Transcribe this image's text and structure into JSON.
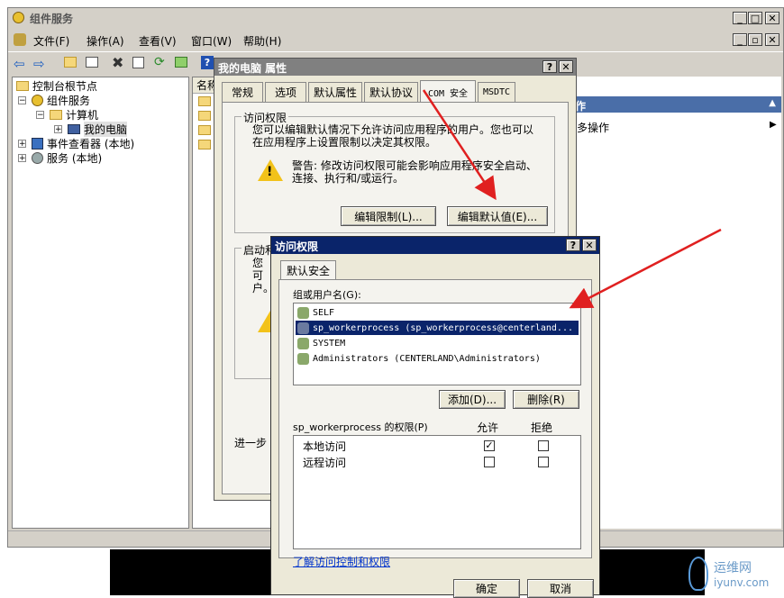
{
  "app": {
    "title": "组件服务",
    "menu": [
      "文件(F)",
      "操作(A)",
      "查看(V)",
      "窗口(W)",
      "帮助(H)"
    ]
  },
  "tree": {
    "root": "控制台根节点",
    "component_services": "组件服务",
    "computers": "计算机",
    "my_computer": "我的电脑",
    "event_viewer": "事件查看器 (本地)",
    "services": "服务 (本地)"
  },
  "list": {
    "column_header": "名称"
  },
  "actions": {
    "header": "作",
    "more": "多操作"
  },
  "props": {
    "title": "我的电脑 属性",
    "tabs": [
      "常规",
      "选项",
      "默认属性",
      "默认协议",
      "COM 安全",
      "MSDTC"
    ],
    "access_group": "访问权限",
    "access_desc": "您可以编辑默认情况下允许访问应用程序的用户。您也可以在应用程序上设置限制以决定其权限。",
    "warning": "警告: 修改访问权限可能会影响应用程序安全启动、连接、执行和/或运行。",
    "edit_limits": "编辑限制(L)...",
    "edit_default": "编辑默认值(E)...",
    "launch_group_partial": "启动和",
    "launch_desc_partial": "您可户。",
    "more_partial": "进一步"
  },
  "access": {
    "title": "访问权限",
    "tab": "默认安全",
    "group_label": "组或用户名(G):",
    "users": [
      "SELF",
      "sp_workerprocess (sp_workerprocess@centerland...",
      "SYSTEM",
      "Administrators (CENTERLAND\\Administrators)"
    ],
    "add": "添加(D)...",
    "remove": "删除(R)",
    "perm_label": "sp_workerprocess 的权限(P)",
    "allow": "允许",
    "deny": "拒绝",
    "permissions": [
      {
        "name": "本地访问",
        "allow": true,
        "deny": false
      },
      {
        "name": "远程访问",
        "allow": false,
        "deny": false
      }
    ],
    "learn_link": "了解访问控制和权限",
    "ok": "确定",
    "cancel": "取消"
  },
  "watermark": {
    "line1": "运维网",
    "line2": "iyunv.com"
  },
  "colors": {
    "title_active": "#0a246a",
    "title_inactive": "#808080",
    "selection": "#0a246a",
    "arrow": "#e02020",
    "face": "#ece9d8"
  }
}
